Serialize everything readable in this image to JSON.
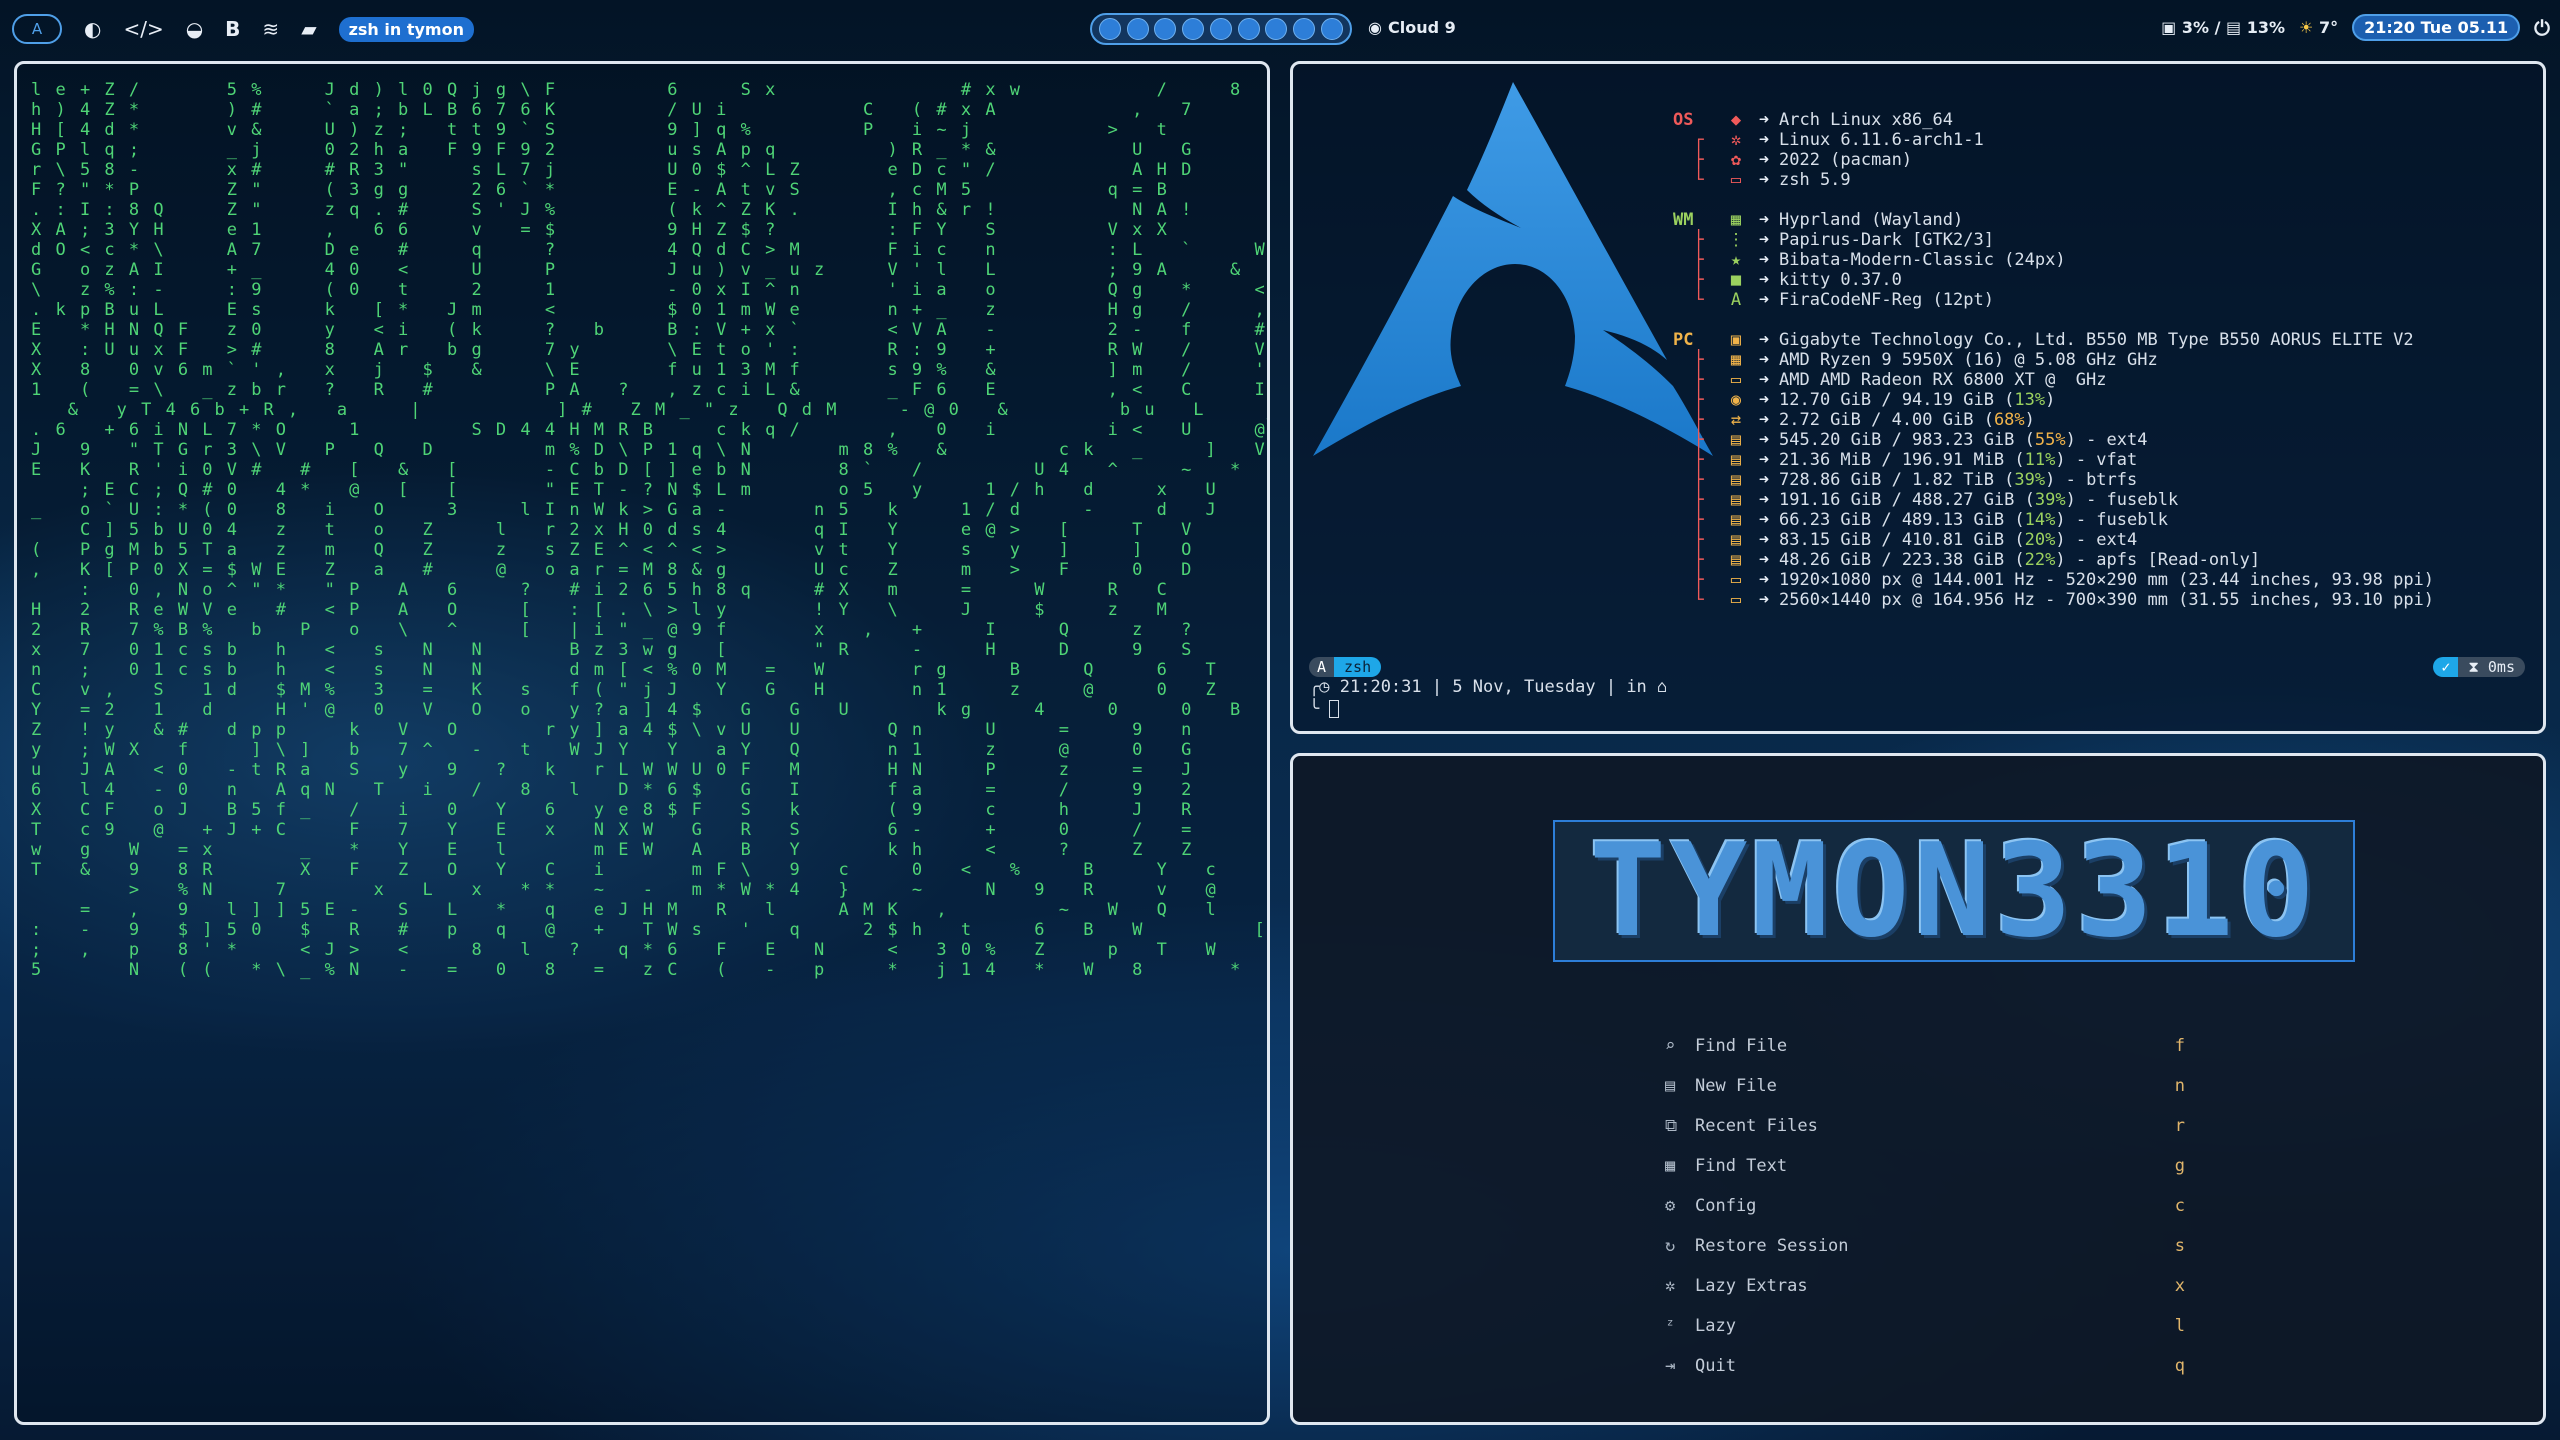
{
  "topbar": {
    "workspace_label": "A",
    "window_title": "zsh in tymon",
    "workspaces": [
      1,
      2,
      3,
      4,
      5,
      6,
      7,
      8,
      9
    ],
    "weather_place": "Cloud 9",
    "cpu": "3%",
    "sep": "/",
    "ram": "13%",
    "temp": "7°",
    "datetime": "21:20 Tue 05.11",
    "icons": [
      "arch-icon",
      "firefox-icon",
      "code-icon",
      "discord-icon",
      "bold-b-icon",
      "spotify-icon",
      "folder-icon"
    ]
  },
  "matrix_lines": [
    "l e + Z /       5 %     J d ) l 0 Q j g \\ F         6     S x               # x w           /     8           L           Y         u       N         E w V",
    "h ) 4 Z *       ) #     ` a ; b L B 6 7 6 K         / U i           C   ( # x A           ,   7           8           (         D       <         + G l",
    "H [ 4 d *       v &     U ) z ;   t t 9 ` S         9 ] q %         P   i ~ j           >   t           9           R       > O       A         s @ s",
    "G P l q ;       _ j     0 2 h a   F 9 F 9 2         u s A p q         ) R _ * &           U   G           2           T       ? Y       [         < 0 e",
    "r \\ 5 8 -       x #     # R 3 \"     s L 7 j         U 0 $ ^ L Z       e D c \" /           A H D         3 V         r <   :   _           k M m",
    "F ? \" * P       Z \"     ( 3 g g     2 6 ` *         E - A t v S       , c M 5           q = B         k !         g s U p   f           q 3 \"",
    ". : I : 8 Q     Z \"     z q . #     S ' J %         ( k ^ Z K .       I h & r !           N A !         A `         Q M - I *           o u V",
    "X A ; 3 Y H     e 1     ,   6 6     v   = $         9 H Z $ ?         : F Y   S         V x X         < h 3       Y : a 3 :             ! j $",
    "d O < c * \\     A 7     D e   #     q     ?         4 Q d C > M       F i c   n         : L   `     W K           w v o L             e a e",
    "G   o z A I     + _     4 0   <     U     P         J u ) v _ u z     V ' l   L         ; 9 A     &   C           V I C Q             U ? 6",
    "\\   z % : -     : 9     ( 0   t     2     1         - 0 x I ^ n       ' i a   o         Q g   *     <   `         * T % O             U 4 m",
    ". k p B u L     E s     k   [ *   J m     <         $ 0 1 m W e       n + _   z         H g   /     ,   `         % .   '             $ 8     Q",
    "E   * H N Q F   z 0     y   < i   ( k     ?   b     B : V + x `       < V A   -         2 -   f     #   J         - r .               < 8     6",
    "X   : U u x F   > #     8   A r   b g     7 y       \\ E t o ' :       R : 9   +         R W   /     V   V         s w u               & O     r",
    "X   8   0 v 6 m ` ' ,   x   j   $   &     \\ E       f u 1 3 M f       s 9 %   &         ] m   /     '   _         R k y               \\ ;     >",
    "1   (   = \\   _ z b r   ?   R   #         P A   ?   , z c i L &       _ F 6   E         , <   C     I   [         V ) m               s (     n",
    "   &   y T 4 6 b + R ,   a     |           ] #   Z M _ \" z   Q d M     - @ 0   &         b u   L     _   ]         [ e G               x :     P",
    ". 6   + 6 i N L 7 * O     1         S D 4 4 H M R B     c k q /       ,   0   i         i <   U     @   J         [ ` -               8 P     R",
    "J   9   \" T G r 3 \\ V   P   Q   D         m % D \\ P 1 q \\ N       m 8 %   &         c k   _     ]   V         v Y ^               ! *     N",
    "E   K   R ' i 0 V #   #   [   &   [       - C b D [ ] e b N       8 `   /         U 4   ^     ~   *         a h h               ` U     C",
    "    ; E C ; Q # 0   4 *   @   [   [       \" E T - ? N $ L m       o 5   y     1 / h   d     x   U         i ; .               2 8     >",
    "_   o ` U : * ( 0   8   i   O     3     l I n W k > G a -       n 5   k     1 / d     -     d   J         1 T R               + H     &",
    "    C ] 5 b U 0 4   z   t   o   Z     l   r 2 x H 0 d s 4       q I   Y     e @ >   [     T   V         p * Z     N         E '     / c",
    "(   P g M b 5 T a   z   m   Q   Z     z   s Z E ^ < ^ < >       v t   Y     s   y   ]     ]   O         * a V     h         A     l 9",
    ",   K [ P 0 X = $ W E   Z   a   #     @   o a r = M 8 & g       U c   Z     m   >   F     0   D         e Z ;     v         /     I \\",
    "    :   0 , N o ^ \" *   \" P   A   6     ?   # i 2 6 5 h 8 q     # X   m     =     W     R   C         [ 1 a     (         \\ *   > B",
    "H   2   R e W V e   #   < P   A   O     [   : [ . \\ > l y       ! Y   \\     J     $     z   M         ' ? 4     (         A     X 4 w",
    "2   R   7 % B %   b   P   o   \\   ^     [   | i \" _ @ 9 f       x   ,   +     I     Q     z   ?         \\       i       4     d ; A",
    "x   7   0 1 c s b   h   <   s   N   N       B z 3 w g   [       \" R     -     H     D     9   S         H M =   :       A     V M N",
    "n   ;   0 1 c s b   h   <   s   N   N       d m [ < % 0 M   =   W       r g     B     Q     6   T         C m 8   ;       6     g M N",
    "C   v ,   S   1 d   $ M %   3   =   K   s   f ( \" j J   Y   G   H       n 1     z     @     0   Z         V # u   '       d     5 ? b",
    "Y   = 2   1   d     H ' @   0   V   O   o   y ? a ] 4 $   G   G   U       k g     4     0     0   B         J 5 S   7       S     j k p",
    "Z   ! y   & #   d p p     k   V   O       r y ] a 4 $ \\ v U   U       Q n     U     =     9   n         y U     P       ~     c 2 2",
    "y   ; W X   f     ] \\ ]   b   7 ^   -   t   W J Y   Y   a Y   Q       n 1     z     @     0   G         U 9     #       s     j [ S",
    "u   J A   < 0   - t R a   S   y   9   ?   k   r L W W U 0 F   M       H N     P     z     =   J         R U     W       ( 0     * 1 L",
    "6   l 4   - 0   n   A q N   T   i   /   8   l   D * 6 $   G   I       f a     =     /     9   2         J V     W       , 0     1 A X",
    "X   C F   o J   B 5 f _   /   i   0   Y   6   y e 8 $ F   S   k       ( 9     c     h     J   R         8 U     H       Y     1 ( J",
    "T   c 9   @   + J + C     F   7   Y   E   x   N X W   G   R   S       6 -     +     0     /   =         # H     W       '     U 1 4",
    "w   g   W   = x       _   *   Y   E   l       m E W   A   B   Y       k h     <     ?     Z   Z         (       3 G 3",
    "T   &   9   8 R       X   F   Z   O   Y   C   i       m F \\   9   c     0   <   %     B     Y   c         E             7 G &",
    "        >   % N     7       x   L   x   * *   ~   -   m * W * 4   }     ~     N   9   R     v   @         _         -     C e p",
    "    =   ,   9   l ] ] 5 E -   S   L   *   q   e J H M   R   l     A M K   ,         ~   W   Q   l     ,         6 0 I     : g Z",
    ":   -   9   $ ] 5 0   $   R   #   p   q   @   +   T W s   '   q     2 $ h   t     6   B   W         [   g     Q   <     / -   ]",
    ";   ,   p   8 ' *     < J >   <     8   l   ?   q * 6   F   E   N     <   3 0 %   Z     p   T   W     d       Q   r     E Q U 3",
    "5       N   ( (   * \\ _ % N   -   =   0   8   =   z C   (   -   p     *   j 1 4   *   W   8       *   ?   *     > * G   ' [ b"
  ],
  "fetch": {
    "os_label": "OS",
    "wm_label": "WM",
    "pc_label": "PC",
    "os": [
      "Arch Linux x86_64",
      "Linux 6.11.6-arch1-1",
      "2022 (pacman)",
      "zsh 5.9"
    ],
    "wm": [
      "Hyprland (Wayland)",
      "Papirus-Dark [GTK2/3]",
      "Bibata-Modern-Classic (24px)",
      "kitty 0.37.0",
      "FiraCodeNF-Reg (12pt)"
    ],
    "pc": [
      {
        "pre": "Gigabyte Technology Co., Ltd. B550 MB Type B550 AORUS ELITE V2",
        "pct": "",
        "post": ""
      },
      {
        "pre": "AMD Ryzen 9 5950X (16) @ 5.08 GHz GHz",
        "pct": "",
        "post": ""
      },
      {
        "pre": "AMD AMD Radeon RX 6800 XT @  GHz",
        "pct": "",
        "post": ""
      },
      {
        "pre": "12.70 GiB / 94.19 GiB (",
        "pct": "13%",
        "post": ")"
      },
      {
        "pre": "2.72 GiB / 4.00 GiB (",
        "pct": "68%",
        "post": ")",
        "warn": true
      },
      {
        "pre": "545.20 GiB / 983.23 GiB (",
        "pct": "55%",
        "post": ") - ext4",
        "warn": true
      },
      {
        "pre": "21.36 MiB / 196.91 MiB (",
        "pct": "11%",
        "post": ") - vfat"
      },
      {
        "pre": "728.86 GiB / 1.82 TiB (",
        "pct": "39%",
        "post": ") - btrfs"
      },
      {
        "pre": "191.16 GiB / 488.27 GiB (",
        "pct": "39%",
        "post": ") - fuseblk"
      },
      {
        "pre": "66.23 GiB / 489.13 GiB (",
        "pct": "14%",
        "post": ") - fuseblk"
      },
      {
        "pre": "83.15 GiB / 410.81 GiB (",
        "pct": "20%",
        "post": ") - ext4"
      },
      {
        "pre": "48.26 GiB / 223.38 GiB (",
        "pct": "22%",
        "post": ") - apfs [Read-only]"
      },
      {
        "pre": "1920×1080 px @ 144.001 Hz - 520×290 mm (23.44 inches, 93.98 ppi)",
        "pct": "",
        "post": ""
      },
      {
        "pre": "2560×1440 px @ 164.956 Hz - 700×390 mm (31.55 inches, 93.10 ppi)",
        "pct": "",
        "post": ""
      }
    ],
    "prompt_arch": "A",
    "prompt_shell": "zsh",
    "status_ok": "✓",
    "status_time": "0ms",
    "prompt_line": "21:20:31 | 5 Nov, Tuesday | in"
  },
  "nvim": {
    "banner": "TYMON3310",
    "menu": [
      {
        "label": "Find File",
        "key": "f",
        "icon": "search-icon"
      },
      {
        "label": "New File",
        "key": "n",
        "icon": "file-icon"
      },
      {
        "label": "Recent Files",
        "key": "r",
        "icon": "copy-icon"
      },
      {
        "label": "Find Text",
        "key": "g",
        "icon": "text-icon"
      },
      {
        "label": "Config",
        "key": "c",
        "icon": "gear-icon"
      },
      {
        "label": "Restore Session",
        "key": "s",
        "icon": "refresh-icon"
      },
      {
        "label": "Lazy Extras",
        "key": "x",
        "icon": "puzzle-icon"
      },
      {
        "label": "Lazy",
        "key": "l",
        "icon": "sleep-icon"
      },
      {
        "label": "Quit",
        "key": "q",
        "icon": "exit-icon"
      }
    ]
  }
}
